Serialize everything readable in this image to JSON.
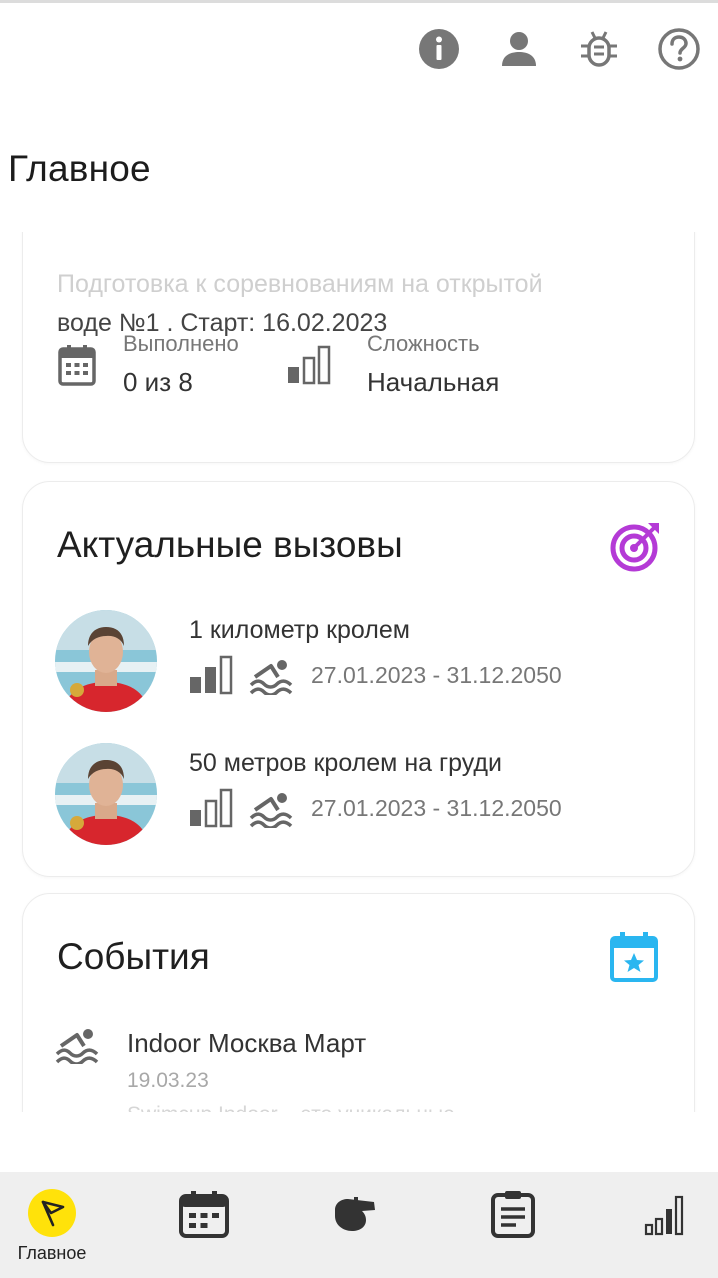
{
  "page": {
    "title": "Главное"
  },
  "topbar": {
    "icons": [
      "info-icon",
      "profile-icon",
      "bug-icon",
      "help-icon"
    ]
  },
  "plan": {
    "text_faded": "Подготовка к соревнованиям на открытой",
    "text": "воде №1 . Старт: 16.02.2023",
    "done_label": "Выполнено",
    "done_value": "0 из 8",
    "difficulty_label": "Сложность",
    "difficulty_value": "Начальная"
  },
  "challenges": {
    "title": "Актуальные вызовы",
    "accent": "#b43ad6",
    "items": [
      {
        "title": "1 километр кролем",
        "dates": "27.01.2023 - 31.12.2050"
      },
      {
        "title": "50 метров кролем на груди",
        "dates": "27.01.2023 - 31.12.2050"
      }
    ]
  },
  "events": {
    "title": "События",
    "accent": "#2ab6f0",
    "items": [
      {
        "title": "Indoor Москва Март",
        "date": "19.03.23",
        "desc": "Swimcup Indoor – это уникальные"
      }
    ]
  },
  "bottom_nav": {
    "active_color": "#ffe20a",
    "items": [
      {
        "label": "Главное",
        "icon": "flag-icon"
      },
      {
        "label": "",
        "icon": "calendar-icon"
      },
      {
        "label": "",
        "icon": "whistle-icon"
      },
      {
        "label": "",
        "icon": "notes-icon"
      },
      {
        "label": "",
        "icon": "stats-icon"
      }
    ]
  }
}
